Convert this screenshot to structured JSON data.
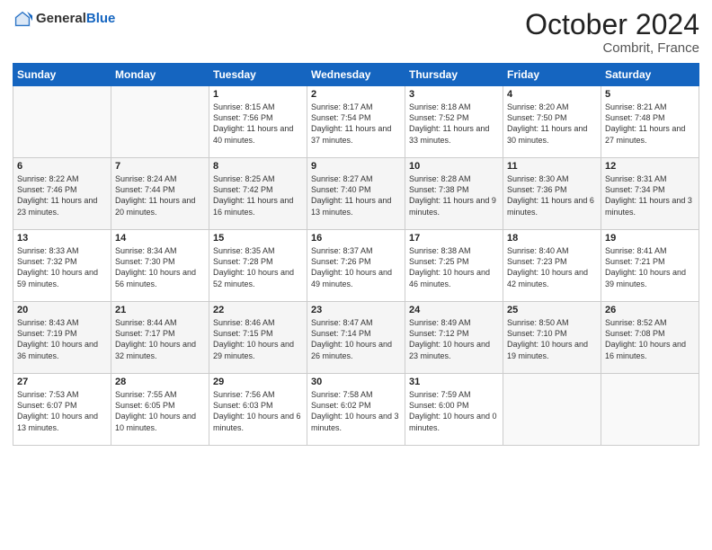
{
  "logo": {
    "general": "General",
    "blue": "Blue"
  },
  "header": {
    "month": "October 2024",
    "location": "Combrit, France"
  },
  "weekdays": [
    "Sunday",
    "Monday",
    "Tuesday",
    "Wednesday",
    "Thursday",
    "Friday",
    "Saturday"
  ],
  "weeks": [
    [
      {
        "day": "",
        "info": ""
      },
      {
        "day": "",
        "info": ""
      },
      {
        "day": "1",
        "info": "Sunrise: 8:15 AM\nSunset: 7:56 PM\nDaylight: 11 hours and 40 minutes."
      },
      {
        "day": "2",
        "info": "Sunrise: 8:17 AM\nSunset: 7:54 PM\nDaylight: 11 hours and 37 minutes."
      },
      {
        "day": "3",
        "info": "Sunrise: 8:18 AM\nSunset: 7:52 PM\nDaylight: 11 hours and 33 minutes."
      },
      {
        "day": "4",
        "info": "Sunrise: 8:20 AM\nSunset: 7:50 PM\nDaylight: 11 hours and 30 minutes."
      },
      {
        "day": "5",
        "info": "Sunrise: 8:21 AM\nSunset: 7:48 PM\nDaylight: 11 hours and 27 minutes."
      }
    ],
    [
      {
        "day": "6",
        "info": "Sunrise: 8:22 AM\nSunset: 7:46 PM\nDaylight: 11 hours and 23 minutes."
      },
      {
        "day": "7",
        "info": "Sunrise: 8:24 AM\nSunset: 7:44 PM\nDaylight: 11 hours and 20 minutes."
      },
      {
        "day": "8",
        "info": "Sunrise: 8:25 AM\nSunset: 7:42 PM\nDaylight: 11 hours and 16 minutes."
      },
      {
        "day": "9",
        "info": "Sunrise: 8:27 AM\nSunset: 7:40 PM\nDaylight: 11 hours and 13 minutes."
      },
      {
        "day": "10",
        "info": "Sunrise: 8:28 AM\nSunset: 7:38 PM\nDaylight: 11 hours and 9 minutes."
      },
      {
        "day": "11",
        "info": "Sunrise: 8:30 AM\nSunset: 7:36 PM\nDaylight: 11 hours and 6 minutes."
      },
      {
        "day": "12",
        "info": "Sunrise: 8:31 AM\nSunset: 7:34 PM\nDaylight: 11 hours and 3 minutes."
      }
    ],
    [
      {
        "day": "13",
        "info": "Sunrise: 8:33 AM\nSunset: 7:32 PM\nDaylight: 10 hours and 59 minutes."
      },
      {
        "day": "14",
        "info": "Sunrise: 8:34 AM\nSunset: 7:30 PM\nDaylight: 10 hours and 56 minutes."
      },
      {
        "day": "15",
        "info": "Sunrise: 8:35 AM\nSunset: 7:28 PM\nDaylight: 10 hours and 52 minutes."
      },
      {
        "day": "16",
        "info": "Sunrise: 8:37 AM\nSunset: 7:26 PM\nDaylight: 10 hours and 49 minutes."
      },
      {
        "day": "17",
        "info": "Sunrise: 8:38 AM\nSunset: 7:25 PM\nDaylight: 10 hours and 46 minutes."
      },
      {
        "day": "18",
        "info": "Sunrise: 8:40 AM\nSunset: 7:23 PM\nDaylight: 10 hours and 42 minutes."
      },
      {
        "day": "19",
        "info": "Sunrise: 8:41 AM\nSunset: 7:21 PM\nDaylight: 10 hours and 39 minutes."
      }
    ],
    [
      {
        "day": "20",
        "info": "Sunrise: 8:43 AM\nSunset: 7:19 PM\nDaylight: 10 hours and 36 minutes."
      },
      {
        "day": "21",
        "info": "Sunrise: 8:44 AM\nSunset: 7:17 PM\nDaylight: 10 hours and 32 minutes."
      },
      {
        "day": "22",
        "info": "Sunrise: 8:46 AM\nSunset: 7:15 PM\nDaylight: 10 hours and 29 minutes."
      },
      {
        "day": "23",
        "info": "Sunrise: 8:47 AM\nSunset: 7:14 PM\nDaylight: 10 hours and 26 minutes."
      },
      {
        "day": "24",
        "info": "Sunrise: 8:49 AM\nSunset: 7:12 PM\nDaylight: 10 hours and 23 minutes."
      },
      {
        "day": "25",
        "info": "Sunrise: 8:50 AM\nSunset: 7:10 PM\nDaylight: 10 hours and 19 minutes."
      },
      {
        "day": "26",
        "info": "Sunrise: 8:52 AM\nSunset: 7:08 PM\nDaylight: 10 hours and 16 minutes."
      }
    ],
    [
      {
        "day": "27",
        "info": "Sunrise: 7:53 AM\nSunset: 6:07 PM\nDaylight: 10 hours and 13 minutes."
      },
      {
        "day": "28",
        "info": "Sunrise: 7:55 AM\nSunset: 6:05 PM\nDaylight: 10 hours and 10 minutes."
      },
      {
        "day": "29",
        "info": "Sunrise: 7:56 AM\nSunset: 6:03 PM\nDaylight: 10 hours and 6 minutes."
      },
      {
        "day": "30",
        "info": "Sunrise: 7:58 AM\nSunset: 6:02 PM\nDaylight: 10 hours and 3 minutes."
      },
      {
        "day": "31",
        "info": "Sunrise: 7:59 AM\nSunset: 6:00 PM\nDaylight: 10 hours and 0 minutes."
      },
      {
        "day": "",
        "info": ""
      },
      {
        "day": "",
        "info": ""
      }
    ]
  ]
}
